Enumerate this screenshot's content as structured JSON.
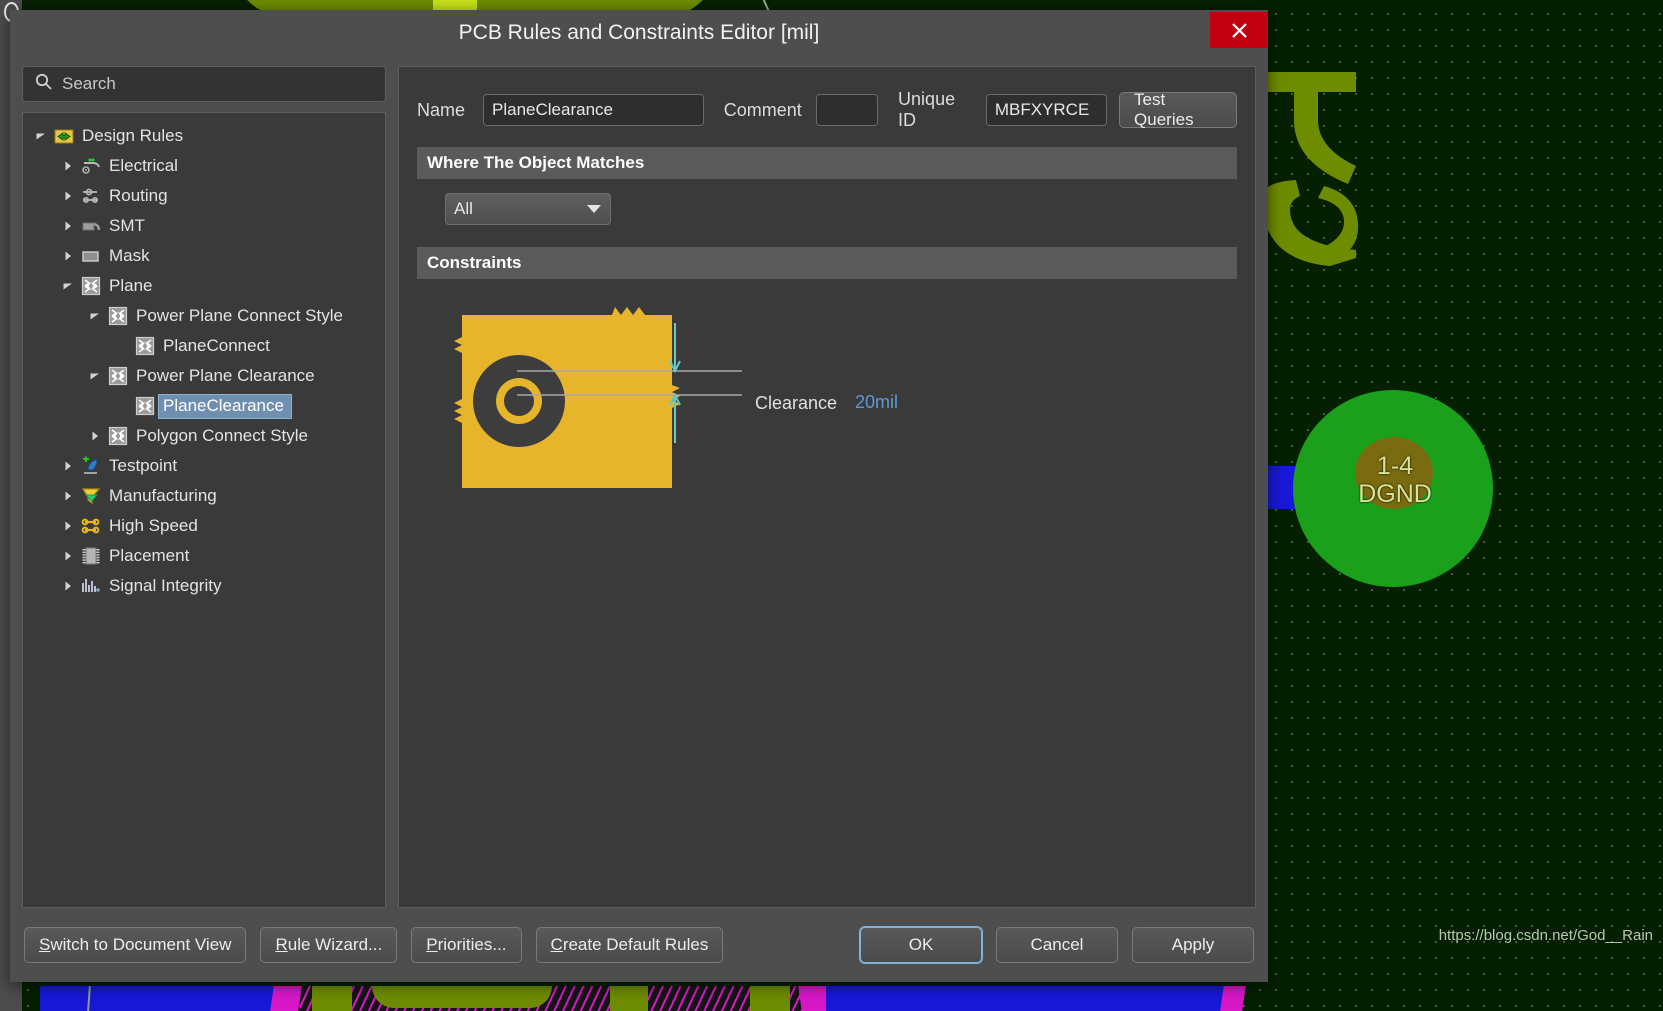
{
  "window": {
    "title": "PCB Rules and Constraints Editor [mil]",
    "close_icon": "close-icon"
  },
  "search": {
    "placeholder": "Search",
    "icon": "search-icon"
  },
  "tree": {
    "items": [
      {
        "label": "Design Rules",
        "depth": 0,
        "twist": "expanded",
        "icon": "design-rules-icon",
        "selected": false
      },
      {
        "label": "Electrical",
        "depth": 1,
        "twist": "collapsed",
        "icon": "electrical-icon",
        "selected": false
      },
      {
        "label": "Routing",
        "depth": 1,
        "twist": "collapsed",
        "icon": "routing-icon",
        "selected": false
      },
      {
        "label": "SMT",
        "depth": 1,
        "twist": "collapsed",
        "icon": "smt-icon",
        "selected": false
      },
      {
        "label": "Mask",
        "depth": 1,
        "twist": "collapsed",
        "icon": "mask-icon",
        "selected": false
      },
      {
        "label": "Plane",
        "depth": 1,
        "twist": "expanded",
        "icon": "plane-icon",
        "selected": false
      },
      {
        "label": "Power Plane Connect Style",
        "depth": 2,
        "twist": "expanded",
        "icon": "plane-icon",
        "selected": false
      },
      {
        "label": "PlaneConnect",
        "depth": 3,
        "twist": "none",
        "icon": "plane-icon",
        "selected": false
      },
      {
        "label": "Power Plane Clearance",
        "depth": 2,
        "twist": "expanded",
        "icon": "plane-icon",
        "selected": false
      },
      {
        "label": "PlaneClearance",
        "depth": 3,
        "twist": "none",
        "icon": "plane-icon",
        "selected": true
      },
      {
        "label": "Polygon Connect Style",
        "depth": 2,
        "twist": "collapsed",
        "icon": "plane-icon",
        "selected": false
      },
      {
        "label": "Testpoint",
        "depth": 1,
        "twist": "collapsed",
        "icon": "testpoint-icon",
        "selected": false
      },
      {
        "label": "Manufacturing",
        "depth": 1,
        "twist": "collapsed",
        "icon": "manufacturing-icon",
        "selected": false
      },
      {
        "label": "High Speed",
        "depth": 1,
        "twist": "collapsed",
        "icon": "high-speed-icon",
        "selected": false
      },
      {
        "label": "Placement",
        "depth": 1,
        "twist": "collapsed",
        "icon": "placement-icon",
        "selected": false
      },
      {
        "label": "Signal Integrity",
        "depth": 1,
        "twist": "collapsed",
        "icon": "signal-integrity-icon",
        "selected": false
      }
    ]
  },
  "form": {
    "name_label": "Name",
    "name_value": "PlaneClearance",
    "comment_label": "Comment",
    "comment_value": "",
    "unique_id_label": "Unique ID",
    "unique_id_value": "MBFXYRCE",
    "test_queries_label": "Test Queries"
  },
  "where_section": {
    "title": "Where The Object Matches",
    "scope_value": "All",
    "scope_caret": "chevron-down-icon"
  },
  "constraints_section": {
    "title": "Constraints",
    "clearance_label": "Clearance",
    "clearance_value": "20mil"
  },
  "footer": {
    "switch_view": "Switch to Document View",
    "switch_view_accel": "S",
    "rule_wizard": "Rule Wizard...",
    "rule_wizard_accel": "R",
    "priorities": "Priorities...",
    "priorities_accel": "P",
    "create_defaults": "Create Default Rules",
    "create_defaults_accel": "C",
    "ok": "OK",
    "cancel": "Cancel",
    "apply": "Apply"
  },
  "background": {
    "pad_label_line1": "1-4",
    "pad_label_line2": "DGND",
    "watermark": "https://blog.csdn.net/God__Rain"
  },
  "colors": {
    "accent_blue": "#5b9bd5",
    "selection_blue": "#6f8fb0",
    "close_red": "#c00010",
    "copper_yellow": "#e6b52c",
    "pcb_green": "#042000",
    "pad_green": "#1aa01a"
  }
}
